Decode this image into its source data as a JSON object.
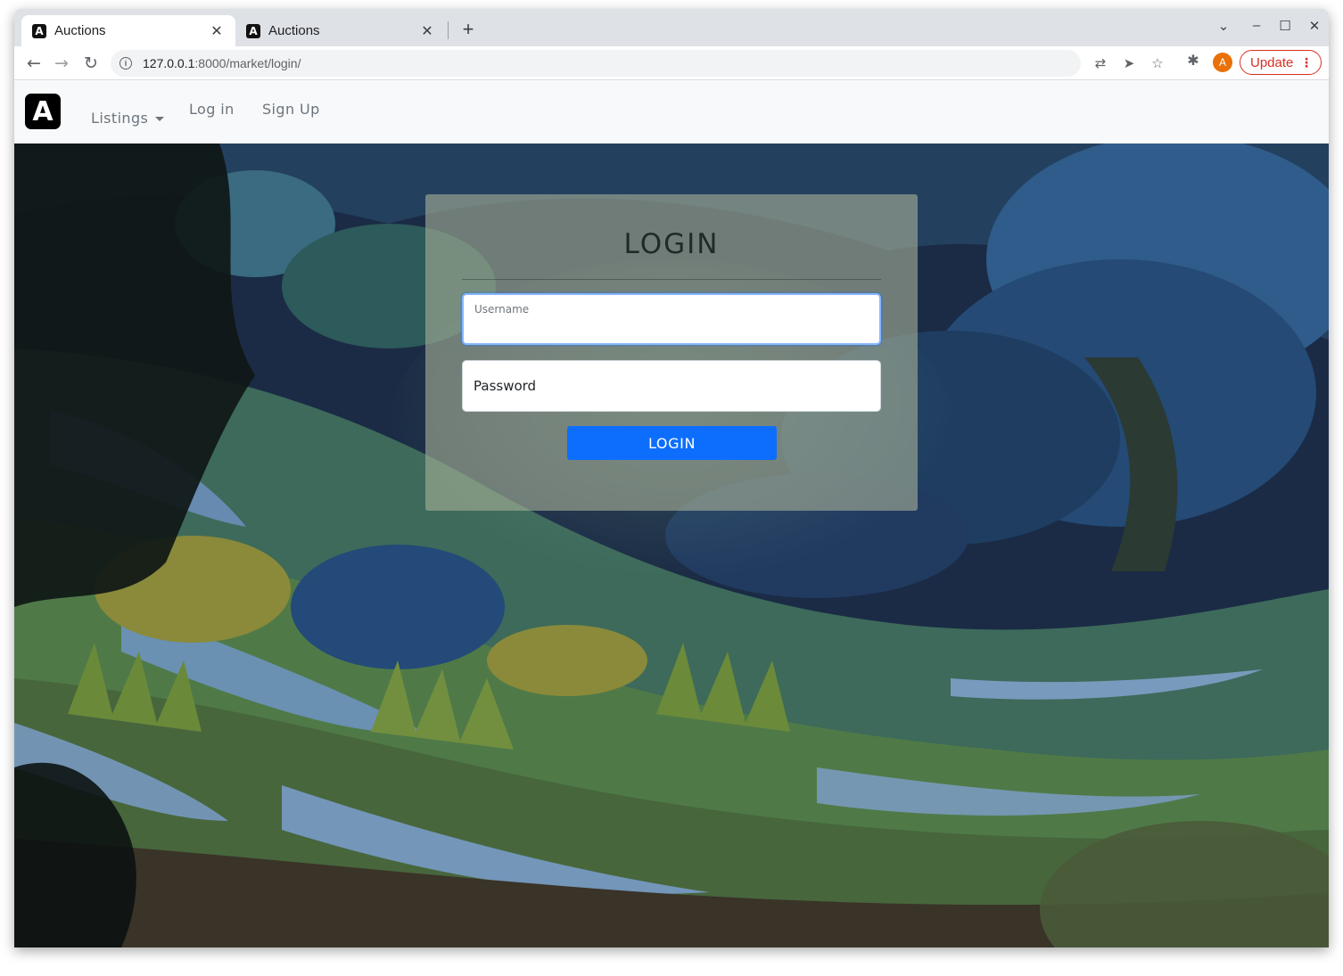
{
  "browser": {
    "tabs": [
      {
        "title": "Auctions",
        "favicon": "A"
      },
      {
        "title": "Auctions",
        "favicon": "A"
      }
    ],
    "new_tab": "+",
    "url_host": "127.0.0.1",
    "url_path": ":8000/market/login/",
    "avatar_letter": "A",
    "update_label": "Update"
  },
  "site": {
    "brand": "A",
    "nav": {
      "listings": "Listings",
      "login": "Log in",
      "signup": "Sign Up"
    }
  },
  "login": {
    "title": "LOGIN",
    "username_label": "Username",
    "password_placeholder": "Password",
    "button": "LOGIN"
  },
  "colors": {
    "primary_button": "#0d6efd",
    "update_red": "#d93025",
    "avatar_orange": "#e8710a"
  }
}
